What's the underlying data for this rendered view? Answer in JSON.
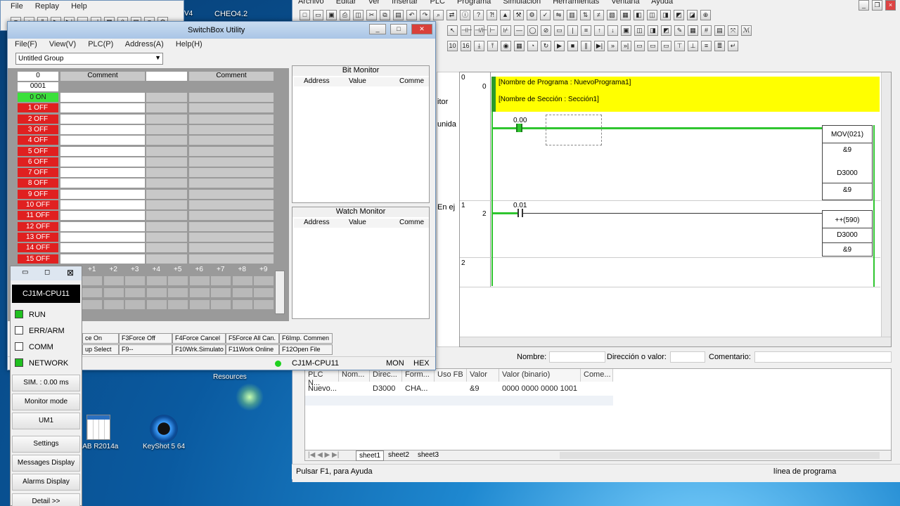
{
  "replay_window": {
    "menu": [
      "File",
      "Replay",
      "Help"
    ]
  },
  "desktop": {
    "top_icon": "CHEO4.2",
    "resources": "Resources",
    "icons": [
      {
        "label": "LAB R2014a"
      },
      {
        "label": "KeyShot 5 64"
      }
    ],
    "cutoff_text": "V4"
  },
  "cx": {
    "menu": [
      "Archivo",
      "Editar",
      "Ver",
      "Insertar",
      "PLC",
      "Programa",
      "Simulación",
      "Herramientas",
      "Ventana",
      "Ayuda"
    ],
    "left_labels": [
      "itor",
      "unida",
      "En ej"
    ],
    "ladder": {
      "rung_numbers": [
        "0",
        "1",
        "2"
      ],
      "rung_steps": [
        "0",
        "2"
      ],
      "program_name": "[Nombre de Programa : NuevoPrograma1]",
      "section_name": "[Nombre de Sección : Sección1]",
      "contact0": "0.00",
      "contact1": "0.01",
      "mov": {
        "name": "MOV(021)",
        "op1": "&9",
        "op2": "D3000",
        "op3": "&9"
      },
      "inc": {
        "name": "++(590)",
        "op1": "D3000",
        "op2": "&9"
      }
    },
    "fields": {
      "nombre": "Nombre:",
      "direccion": "Dirección o valor:",
      "comentario": "Comentario:"
    },
    "watch": {
      "headers": [
        "PLC N...",
        "Nom...",
        "Direc...",
        "Form...",
        "Uso FB",
        "Valor",
        "Valor (binario)",
        "Come..."
      ],
      "row": [
        "Nuevo...",
        "",
        "D3000",
        "CHA...",
        "",
        "&9",
        "0000 0000 0000 1001",
        ""
      ]
    },
    "sheets": [
      "sheet1",
      "sheet2",
      "sheet3"
    ],
    "status_left": "Pulsar F1, para Ayuda",
    "status_right": "línea de programa"
  },
  "switchbox": {
    "title": "SwitchBox Utility",
    "menu": [
      "File(F)",
      "View(V)",
      "PLC(P)",
      "Address(A)",
      "Help(H)"
    ],
    "group": "Untitled Group",
    "col_header_addr": "0",
    "col_header_comment": "Comment",
    "col_header_comment2": "Comment",
    "address": "0001",
    "bits": [
      {
        "n": "0",
        "s": "ON"
      },
      {
        "n": "1",
        "s": "OFF"
      },
      {
        "n": "2",
        "s": "OFF"
      },
      {
        "n": "3",
        "s": "OFF"
      },
      {
        "n": "4",
        "s": "OFF"
      },
      {
        "n": "5",
        "s": "OFF"
      },
      {
        "n": "6",
        "s": "OFF"
      },
      {
        "n": "7",
        "s": "OFF"
      },
      {
        "n": "8",
        "s": "OFF"
      },
      {
        "n": "9",
        "s": "OFF"
      },
      {
        "n": "10",
        "s": "OFF"
      },
      {
        "n": "11",
        "s": "OFF"
      },
      {
        "n": "12",
        "s": "OFF"
      },
      {
        "n": "13",
        "s": "OFF"
      },
      {
        "n": "14",
        "s": "OFF"
      },
      {
        "n": "15",
        "s": "OFF"
      }
    ],
    "offsets": [
      "+1",
      "+2",
      "+3",
      "+4",
      "+5",
      "+6",
      "+7",
      "+8",
      "+9"
    ],
    "bit_monitor": {
      "title": "Bit Monitor",
      "cols": [
        "Address",
        "Value",
        "Comme"
      ]
    },
    "watch_monitor": {
      "title": "Watch Monitor",
      "cols": [
        "Address",
        "Value",
        "Comme"
      ]
    },
    "fkeys_row1": [
      "ce On",
      "F3Force Off",
      "F4Force Cancel",
      "F5Force All Can.",
      "F6Imp. Commen"
    ],
    "fkeys_row2": [
      "up Select",
      "F9--",
      "F10Wrk.Simulato",
      "F11Work Online",
      "F12Open File"
    ],
    "status": {
      "cpu": "CJ1M-CPU11",
      "mode": "MON",
      "fmt": "HEX"
    }
  },
  "side_panel": {
    "cpu": "CJ1M-CPU11",
    "leds": [
      {
        "label": "RUN",
        "on": true
      },
      {
        "label": "ERR/ARM",
        "on": false
      },
      {
        "label": "COMM",
        "on": false
      },
      {
        "label": "NETWORK",
        "on": true
      }
    ],
    "sim": "SIM. : 0.00 ms",
    "buttons": [
      "Monitor mode",
      "UM1",
      "Settings",
      "Messages Display",
      "Alarms Display",
      "Detail >>"
    ]
  }
}
